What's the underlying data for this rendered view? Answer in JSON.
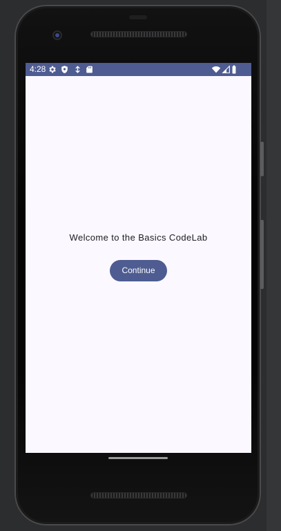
{
  "status_bar": {
    "time": "4:28",
    "left_icons": [
      "gear-icon",
      "shield-icon",
      "data-arrows-icon",
      "sd-card-icon"
    ],
    "right_icons": [
      "wifi-icon",
      "signal-icon",
      "battery-icon"
    ]
  },
  "main": {
    "welcome_text": "Welcome to the Basics CodeLab",
    "continue_label": "Continue"
  },
  "colors": {
    "primary": "#4e5c91",
    "background": "#fcf8ff",
    "on_background": "#1b1b21"
  }
}
